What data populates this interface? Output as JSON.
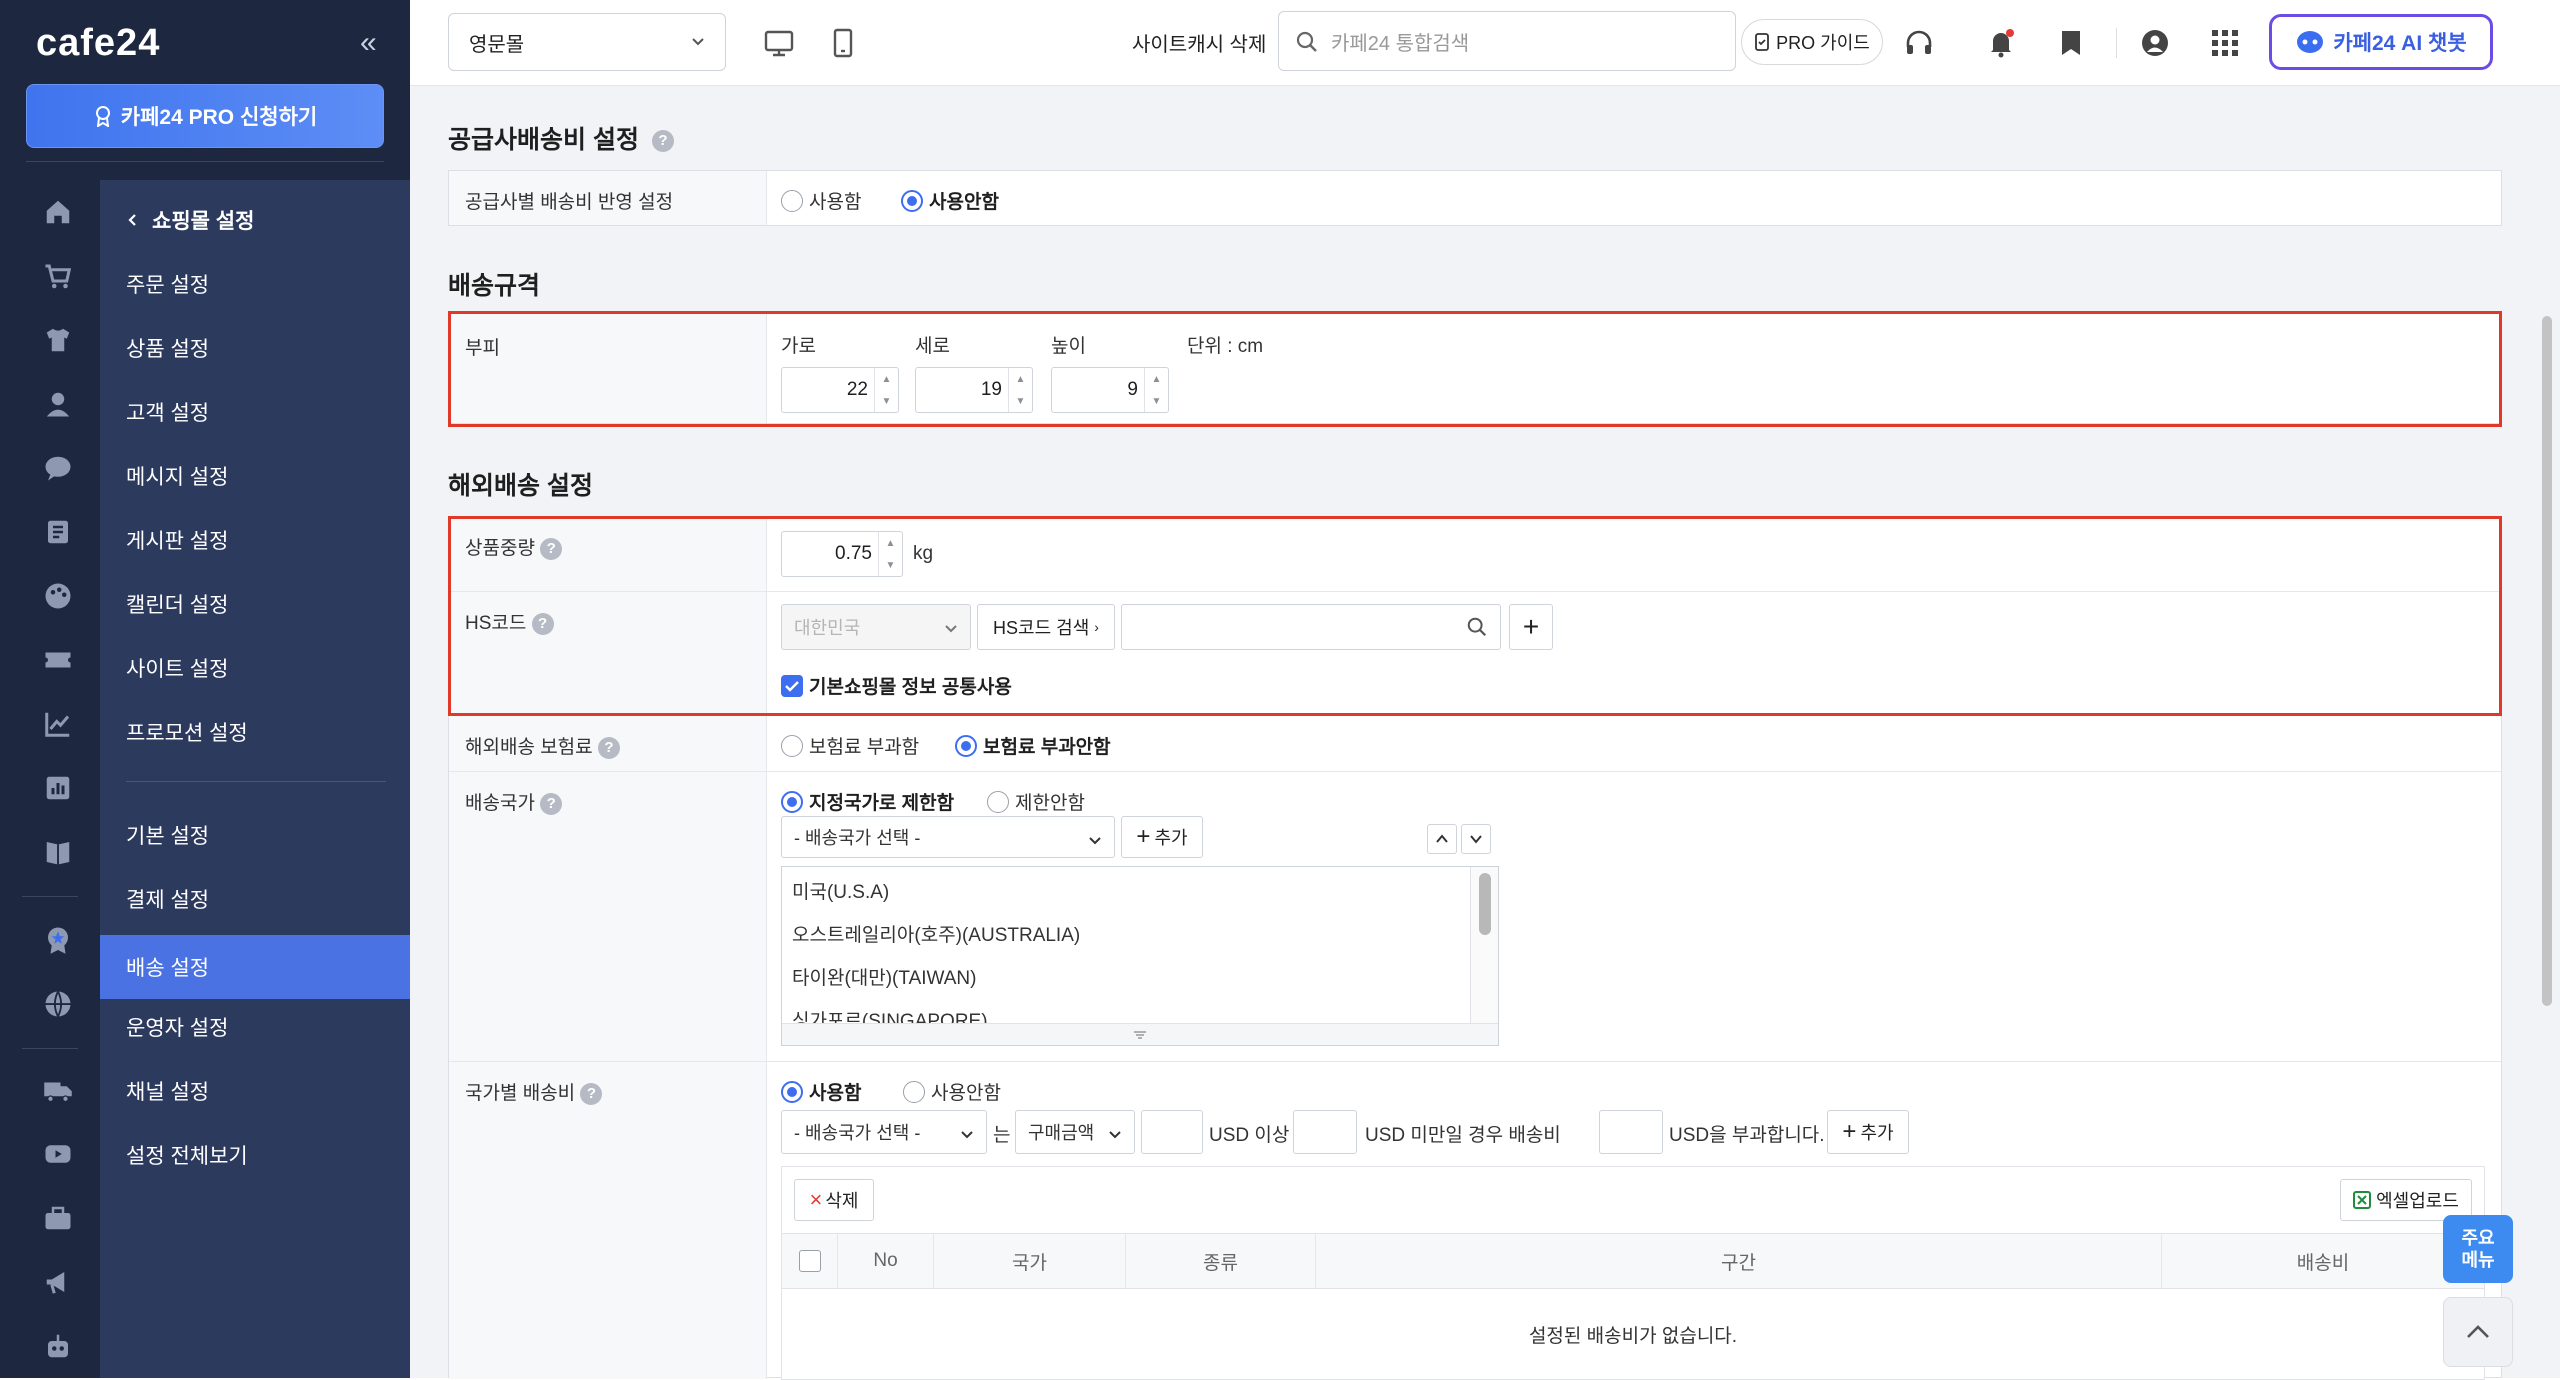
{
  "sidebar": {
    "brand": "cafe24",
    "collapse_label": "«",
    "pro_button": "카페24 PRO 신청하기",
    "rail_icons": [
      "home-icon",
      "cart-icon",
      "tshirt-icon",
      "person-icon",
      "chat-icon",
      "board-icon",
      "palette-icon",
      "ticket-icon",
      "chart-icon",
      "stats-icon",
      "book-icon",
      "badge-icon",
      "globe-icon",
      "truck-icon",
      "play-icon",
      "toolbox-icon",
      "megaphone-icon",
      "robot-icon"
    ],
    "menu_back": "쇼핑몰 설정",
    "menu_group1": [
      "주문 설정",
      "상품 설정",
      "고객 설정",
      "메시지 설정",
      "게시판 설정",
      "캘린더 설정",
      "사이트 설정",
      "프로모션 설정"
    ],
    "menu_group2": [
      "기본 설정",
      "결제 설정",
      "배송 설정",
      "운영자 설정",
      "채널 설정",
      "설정 전체보기"
    ],
    "active_item": "배송 설정"
  },
  "topbar": {
    "mall_select": "영문몰",
    "cache_delete": "사이트캐시 삭제",
    "search_placeholder": "카페24 통합검색",
    "pro_guide": "PRO 가이드",
    "chatbot": "카페24 AI 챗봇"
  },
  "supplier_section": {
    "title": "공급사배송비 설정",
    "row_label": "공급사별 배송비 반영 설정",
    "options": [
      "사용함",
      "사용안함"
    ],
    "selected": "사용안함"
  },
  "spec_section": {
    "title": "배송규격",
    "row_label": "부피",
    "width_label": "가로",
    "depth_label": "세로",
    "height_label": "높이",
    "unit_label": "단위 : cm",
    "width": "22",
    "depth": "19",
    "height": "9"
  },
  "overseas_section": {
    "title": "해외배송 설정",
    "weight_label": "상품중량",
    "weight_value": "0.75",
    "weight_unit": "kg",
    "hs_label": "HS코드",
    "hs_country": "대한민국",
    "hs_search_btn": "HS코드 검색",
    "hs_add": "+",
    "share_checkbox": "기본쇼핑몰 정보 공통사용",
    "insurance_label": "해외배송 보험료",
    "insurance_options": [
      "보험료 부과함",
      "보험료 부과안함"
    ],
    "insurance_selected": "보험료 부과안함",
    "country_label": "배송국가",
    "country_options": [
      "지정국가로 제한함",
      "제한안함"
    ],
    "country_selected": "지정국가로 제한함",
    "country_select": "- 배송국가 선택 -",
    "add_button": "추가",
    "countries": [
      "미국(U.S.A)",
      "오스트레일리아(호주)(AUSTRALIA)",
      "타이완(대만)(TAIWAN)",
      "싱가포르(SINGAPORE)"
    ],
    "fee_label": "국가별 배송비",
    "fee_options": [
      "사용함",
      "사용안함"
    ],
    "fee_selected": "사용함",
    "fee_country_select": "- 배송국가 선택 -",
    "fee_eun": "는",
    "fee_basis_select": "구매금액",
    "fee_usd_over": "USD 이상",
    "fee_usd_under": "USD 미만일 경우 배송비",
    "fee_usd_charge": "USD을 부과합니다.",
    "fee_add": "추가",
    "delete_btn": "삭제",
    "excel_btn": "엑셀업로드",
    "table_headers": [
      "No",
      "국가",
      "종류",
      "구간",
      "배송비"
    ],
    "empty_message": "설정된 배송비가 없습니다."
  },
  "floating": {
    "quick_menu": "주요 메뉴"
  }
}
